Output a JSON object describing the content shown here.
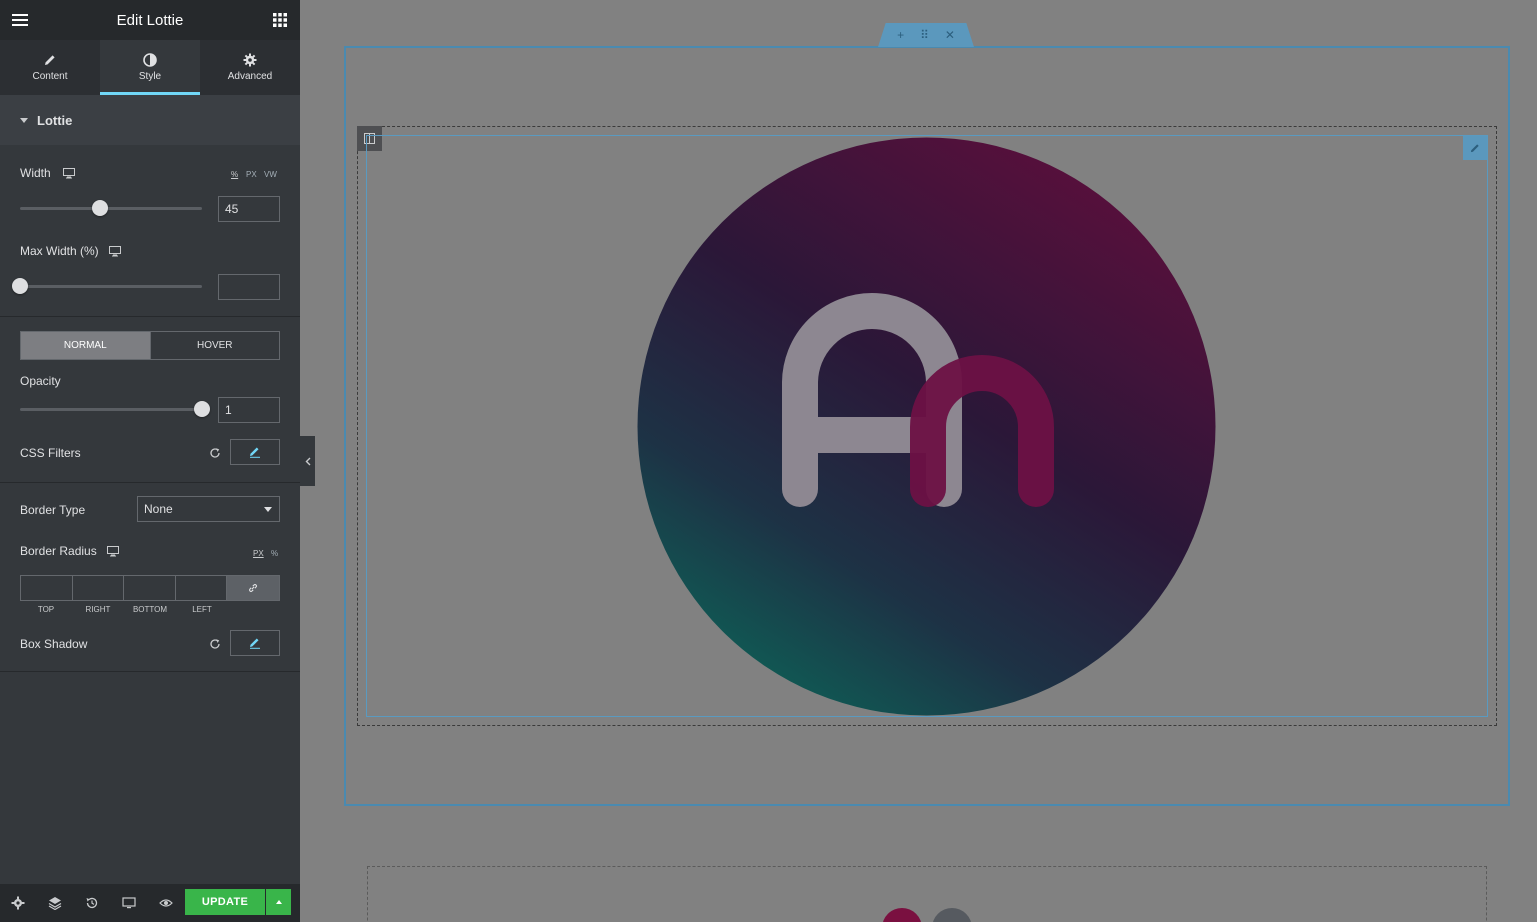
{
  "panel": {
    "title": "Edit Lottie",
    "tabs": [
      {
        "label": "Content",
        "icon": "pencil-icon"
      },
      {
        "label": "Style",
        "icon": "contrast-icon"
      },
      {
        "label": "Advanced",
        "icon": "gear-icon"
      }
    ],
    "active_tab": "Style",
    "section_title": "Lottie"
  },
  "controls": {
    "width": {
      "label": "Width",
      "units": [
        "%",
        "PX",
        "VW"
      ],
      "selected_unit": "%",
      "value": "45",
      "slider_fraction": 0.45
    },
    "max_width": {
      "label": "Max Width (%)",
      "value": "",
      "slider_fraction": 0
    },
    "state_tabs": {
      "normal": "NORMAL",
      "hover": "HOVER",
      "active": "NORMAL"
    },
    "opacity": {
      "label": "Opacity",
      "value": "1",
      "slider_fraction": 1
    },
    "css_filters": {
      "label": "CSS Filters"
    },
    "border_type": {
      "label": "Border Type",
      "selected": "None"
    },
    "border_radius": {
      "label": "Border Radius",
      "units": [
        "PX",
        "%"
      ],
      "selected_unit": "PX",
      "sides": [
        "TOP",
        "RIGHT",
        "BOTTOM",
        "LEFT"
      ]
    },
    "box_shadow": {
      "label": "Box Shadow"
    }
  },
  "footer": {
    "update_label": "UPDATE",
    "icons": [
      "settings-icon",
      "layers-icon",
      "history-icon",
      "responsive-icon",
      "preview-icon"
    ]
  },
  "colors": {
    "accent": "#71d7f7",
    "update_green": "#39b54a",
    "selection_blue": "#5b98bd",
    "logo_magenta": "#a3124f",
    "logo_teal": "#0f6b5a"
  }
}
